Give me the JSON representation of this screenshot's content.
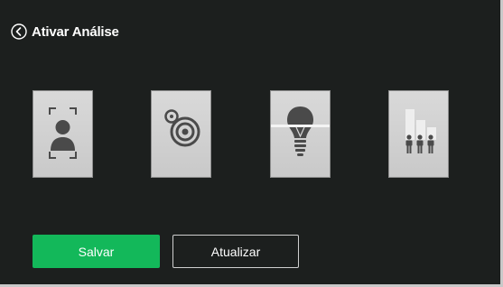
{
  "header": {
    "title": "Ativar Análise"
  },
  "tiles": [
    {
      "icon": "face-detection-icon"
    },
    {
      "icon": "camera-lens-icon"
    },
    {
      "icon": "lightbulb-icon"
    },
    {
      "icon": "people-counting-icon"
    }
  ],
  "actions": {
    "save_label": "Salvar",
    "update_label": "Atualizar"
  },
  "colors": {
    "background": "#1c1f1e",
    "accent": "#13b85a",
    "tile": "#d0d0d0",
    "icon": "#4a4a4a"
  }
}
